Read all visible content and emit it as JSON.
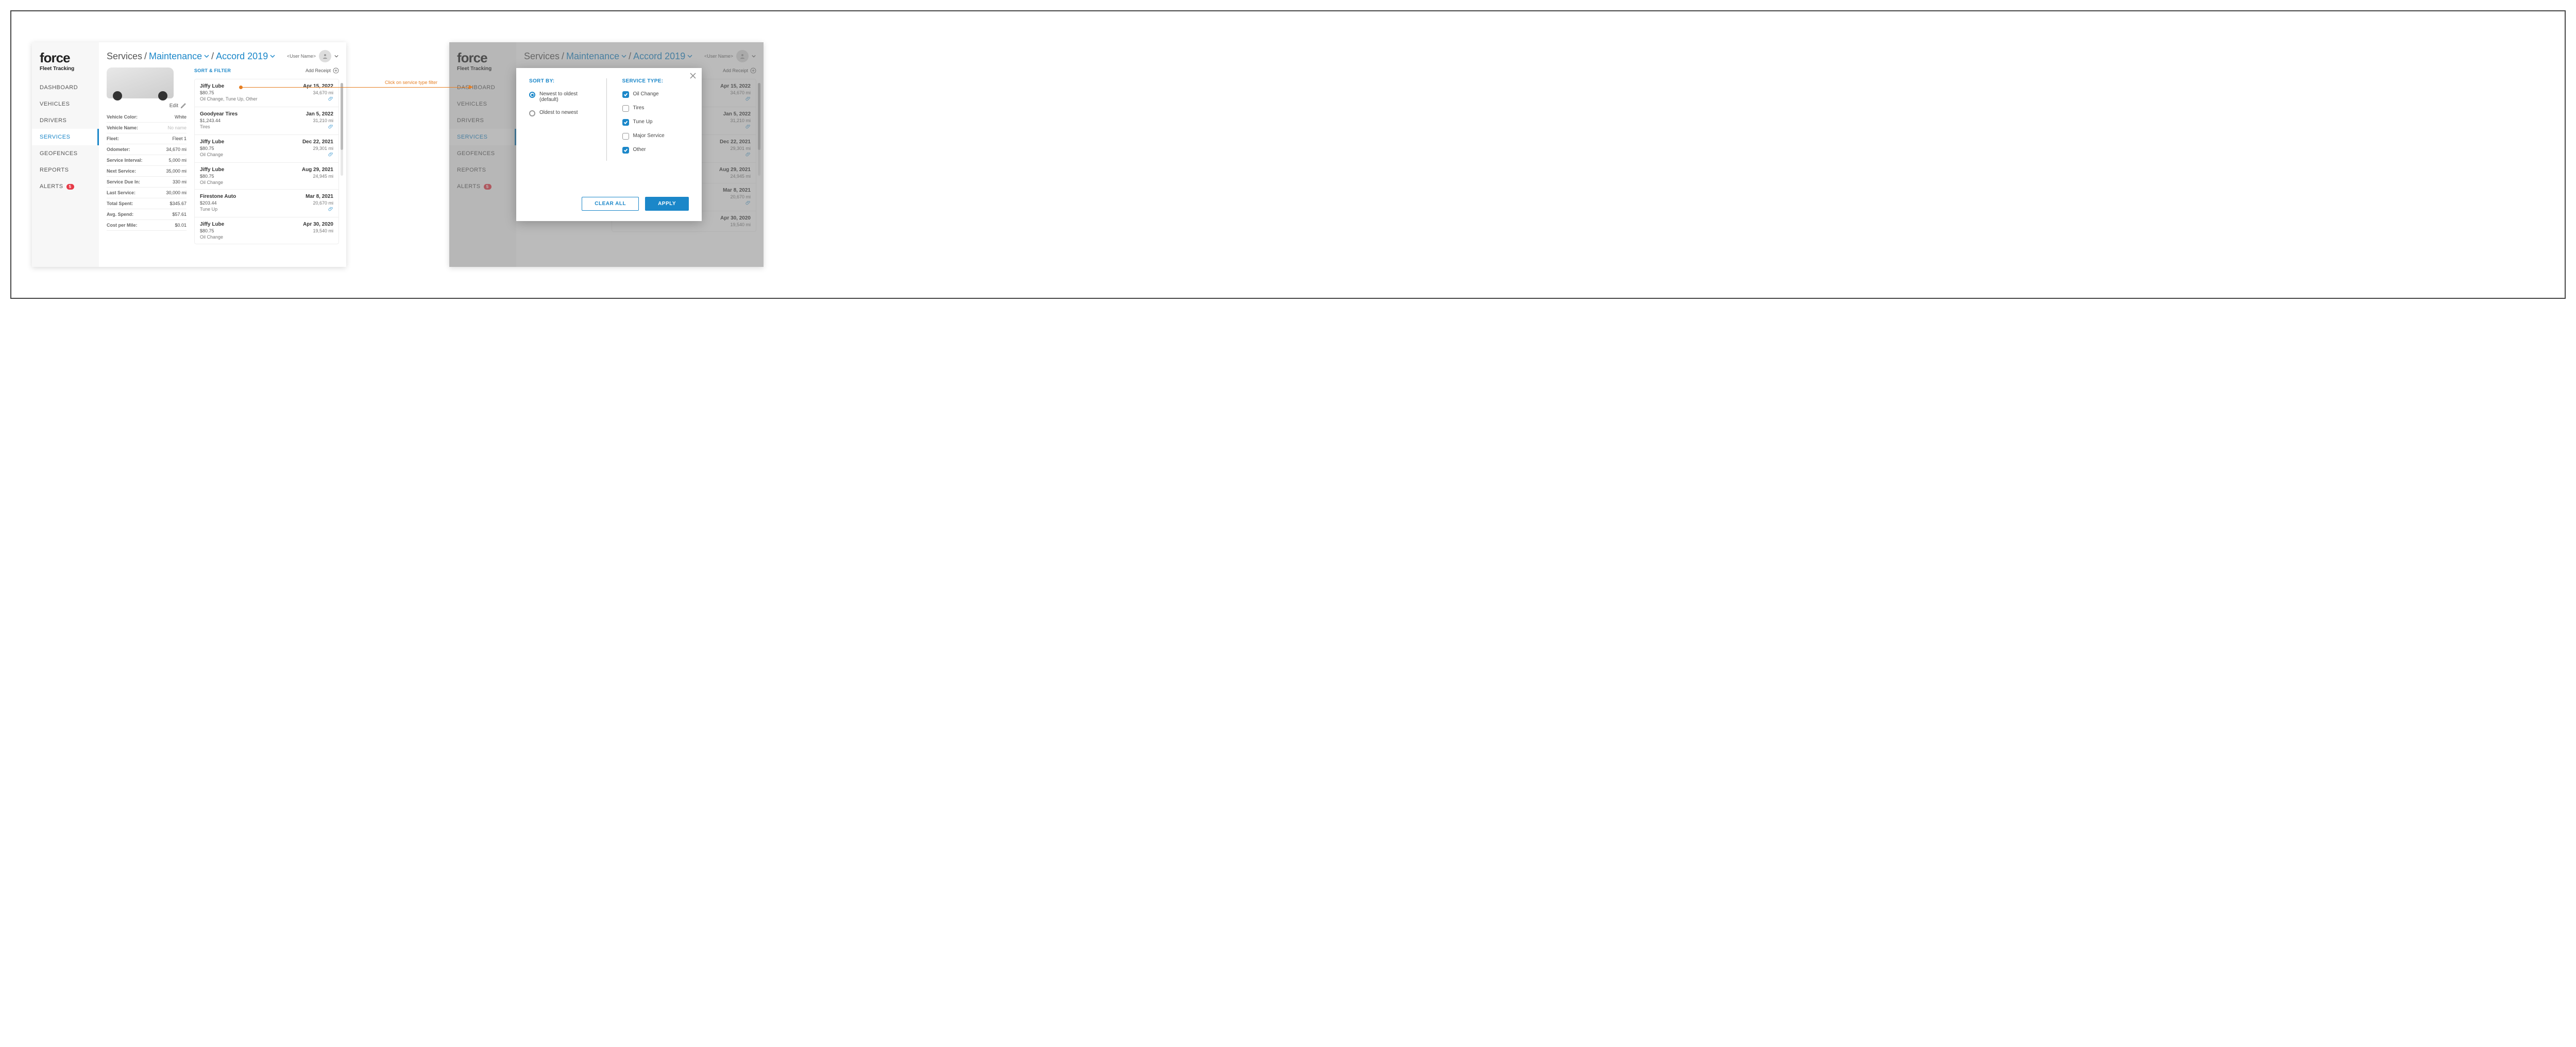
{
  "logo": {
    "main": "force",
    "sub": "Fleet Tracking"
  },
  "nav": [
    {
      "label": "DASHBOARD"
    },
    {
      "label": "VEHICLES"
    },
    {
      "label": "DRIVERS"
    },
    {
      "label": "SERVICES",
      "active": true
    },
    {
      "label": "GEOFENCES"
    },
    {
      "label": "REPORTS"
    },
    {
      "label": "ALERTS",
      "badge": "5"
    }
  ],
  "breadcrumb": {
    "root": "Services",
    "level1": "Maintenance",
    "level2": "Accord 2019"
  },
  "user": {
    "name": "<User Name>"
  },
  "left_panel": {
    "edit": "Edit",
    "details": [
      {
        "label": "Vehicle Color:",
        "value": "White"
      },
      {
        "label": "Vehicle Name:",
        "value": "No name",
        "placeholder": true
      },
      {
        "label": "Fleet:",
        "value": "Fleet 1"
      },
      {
        "label": "Odometer:",
        "value": "34,670 mi"
      },
      {
        "label": "Service Interval:",
        "value": "5,000 mi"
      },
      {
        "label": "Next Service:",
        "value": "35,000 mi"
      },
      {
        "label": "Service Due In:",
        "value": "330 mi"
      },
      {
        "label": "Last Service:",
        "value": "30,000 mi"
      },
      {
        "label": "Total Spent:",
        "value": "$345.67"
      },
      {
        "label": "Avg. Spend:",
        "value": "$57.61"
      },
      {
        "label": "Cost per Mile:",
        "value": "$0.01"
      }
    ]
  },
  "toolbar": {
    "sort_filter": "SORT & FILTER",
    "add_receipt": "Add Receipt"
  },
  "services": [
    {
      "name": "Jiffy Lube",
      "price": "$80.75",
      "types": "Oil Change, Tune Up, Other",
      "date": "Apr 15, 2022",
      "miles": "34,670 mi",
      "attach": true
    },
    {
      "name": "Goodyear Tires",
      "price": "$1,243.44",
      "types": "Tires",
      "date": "Jan 5, 2022",
      "miles": "31,210 mi",
      "attach": true
    },
    {
      "name": "Jiffy Lube",
      "price": "$80.75",
      "types": "Oil Change",
      "date": "Dec 22, 2021",
      "miles": "29,301 mi",
      "attach": true
    },
    {
      "name": "Jiffy Lube",
      "price": "$80.75",
      "types": "Oil Change",
      "date": "Aug 29, 2021",
      "miles": "24,945 mi",
      "attach": false
    },
    {
      "name": "Firestone Auto",
      "price": "$203.44",
      "types": "Tune Up",
      "date": "Mar 8, 2021",
      "miles": "20,670 mi",
      "attach": true
    },
    {
      "name": "Jiffy Lube",
      "price": "$80.75",
      "types": "Oil Change",
      "date": "Apr 30, 2020",
      "miles": "19,540 mi",
      "attach": false
    }
  ],
  "modal": {
    "sort_by": "SORT BY:",
    "service_type": "SERVICE TYPE:",
    "sort_options": [
      {
        "label": "Newest to oldest (default)",
        "checked": true
      },
      {
        "label": "Oldest to newest",
        "checked": false
      }
    ],
    "type_options": [
      {
        "label": "Oil Change",
        "checked": true
      },
      {
        "label": "Tires",
        "checked": false
      },
      {
        "label": "Tune Up",
        "checked": true
      },
      {
        "label": "Major Service",
        "checked": false
      },
      {
        "label": "Other",
        "checked": true
      }
    ],
    "clear": "CLEAR ALL",
    "apply": "APPLY"
  },
  "annotation": "Click on service type filter"
}
